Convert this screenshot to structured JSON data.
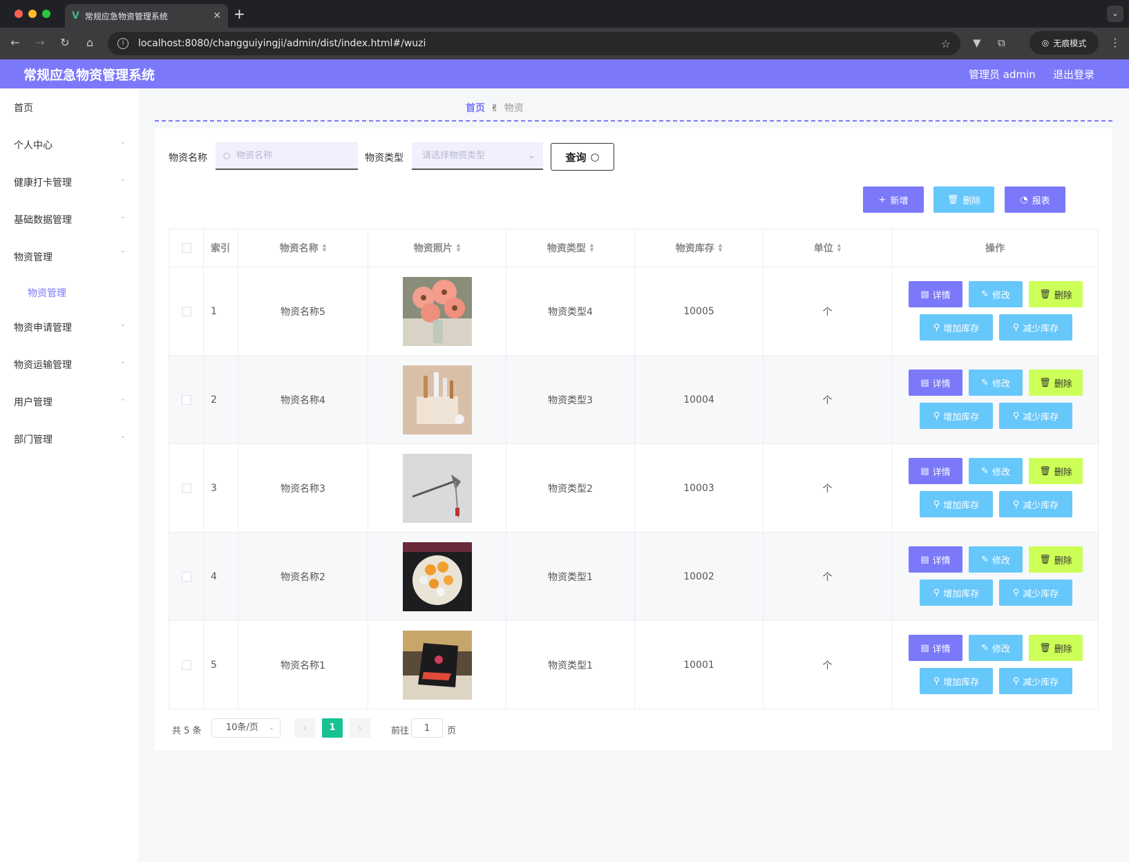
{
  "browser": {
    "tab_title": "常规应急物资管理系统",
    "url": "localhost:8080/changguiyingji/admin/dist/index.html#/wuzi",
    "incognito_label": "无痕模式"
  },
  "header": {
    "title": "常规应急物资管理系统",
    "user": "管理员 admin",
    "logout": "退出登录"
  },
  "sidebar": {
    "items": [
      {
        "label": "首页"
      },
      {
        "label": "个人中心"
      },
      {
        "label": "健康打卡管理"
      },
      {
        "label": "基础数据管理"
      },
      {
        "label": "物资管理"
      },
      {
        "label": "物资申请管理"
      },
      {
        "label": "物资运输管理"
      },
      {
        "label": "用户管理"
      },
      {
        "label": "部门管理"
      }
    ],
    "sub_item": "物资管理"
  },
  "breadcrumb": {
    "home": "首页",
    "sep": "✌",
    "current": "物资"
  },
  "search": {
    "name_label": "物资名称",
    "name_placeholder": "物资名称",
    "type_label": "物资类型",
    "type_placeholder": "请选择物资类型",
    "query_label": "查询"
  },
  "toolbar": {
    "add": "新增",
    "delete": "删除",
    "report": "报表"
  },
  "table": {
    "headers": [
      "索引",
      "物资名称",
      "物资照片",
      "物资类型",
      "物资库存",
      "单位",
      "操作"
    ],
    "rows": [
      {
        "index": "1",
        "name": "物资名称5",
        "type": "物资类型4",
        "stock": "10005",
        "unit": "个"
      },
      {
        "index": "2",
        "name": "物资名称4",
        "type": "物资类型3",
        "stock": "10004",
        "unit": "个"
      },
      {
        "index": "3",
        "name": "物资名称3",
        "type": "物资类型2",
        "stock": "10003",
        "unit": "个"
      },
      {
        "index": "4",
        "name": "物资名称2",
        "type": "物资类型1",
        "stock": "10002",
        "unit": "个"
      },
      {
        "index": "5",
        "name": "物资名称1",
        "type": "物资类型1",
        "stock": "10001",
        "unit": "个"
      }
    ],
    "actions": {
      "detail": "详情",
      "edit": "修改",
      "delete": "删除",
      "add_stock": "增加库存",
      "reduce_stock": "减少库存"
    }
  },
  "pagination": {
    "total": "共 5 条",
    "page_size": "10条/页",
    "current": "1",
    "goto": "前往",
    "goto_value": "1",
    "page_suffix": "页"
  },
  "colors": {
    "accent": "#7b78f9",
    "info": "#66c7fa",
    "lime": "#ccff57",
    "pager": "#17c294"
  }
}
